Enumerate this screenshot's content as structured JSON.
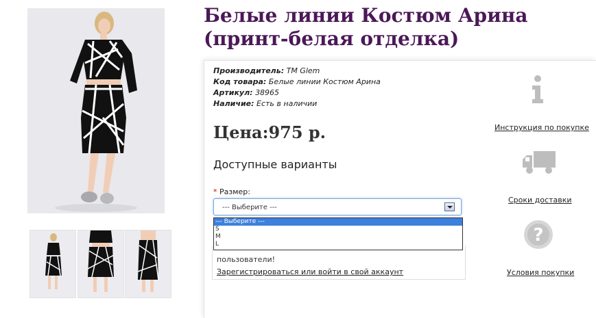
{
  "product": {
    "title": "Белые линии Костюм Арина (принт-белая отделка)",
    "manufacturer_label": "Производитель:",
    "manufacturer_value": "TM Glem",
    "code_label": "Код товара:",
    "code_value": "Белые линии Костюм Арина",
    "sku_label": "Артикул:",
    "sku_value": "38965",
    "stock_label": "Наличие:",
    "stock_value": "Есть в наличии",
    "price": "Цена:975 р."
  },
  "options": {
    "heading": "Доступные варианты",
    "required_mark": "*",
    "size_label": "Размер:",
    "selected": "--- Выберите ---",
    "list": [
      "--- Выберите ---",
      "S",
      "M",
      "L"
    ]
  },
  "login": {
    "text": "пользователи!",
    "link": "Зарегистрироваться или войти в свой аккаунт"
  },
  "sidebar": {
    "instructions": "Инструкция по покупке",
    "delivery": "Сроки доставки",
    "terms": "Условия покупки"
  },
  "colors": {
    "title": "#4b1857",
    "accent": "#3d80dd"
  }
}
